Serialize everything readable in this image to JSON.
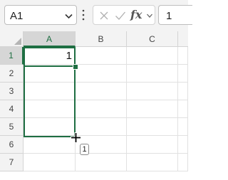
{
  "formula_bar": {
    "name_box_value": "A1",
    "formula_value": "1",
    "fx_label": "fx"
  },
  "columns": [
    "A",
    "B",
    "C"
  ],
  "rows": [
    "1",
    "2",
    "3",
    "4",
    "5",
    "6",
    "7"
  ],
  "cells": {
    "A1": "1"
  },
  "selection": {
    "range": "A1:A5",
    "active_cell": "A1"
  },
  "autofill_tooltip": "1",
  "colors": {
    "accent": "#1e6e42",
    "header_bg": "#f3f3f3",
    "header_active_bg": "#d6d6d6",
    "grid_line": "#e1e1e1"
  }
}
